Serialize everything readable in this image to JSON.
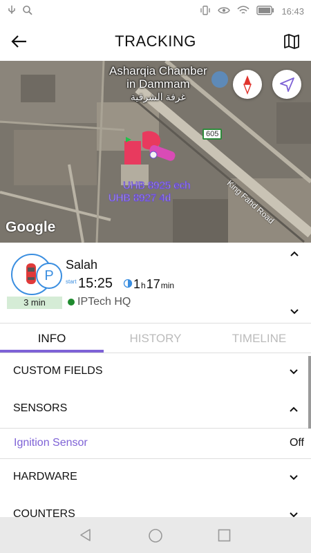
{
  "status_bar": {
    "time": "16:43",
    "icons_left": [
      "usb-icon",
      "search-icon"
    ],
    "icons_right": [
      "vibrate-icon",
      "eye-icon",
      "wifi-icon",
      "battery-icon"
    ]
  },
  "header": {
    "title": "TRACKING",
    "back_icon": "arrow-left-icon",
    "map_icon": "map-icon"
  },
  "map": {
    "poi_name_line1": "Asharqia Chamber",
    "poi_name_line2": "in Dammam",
    "poi_name_arabic": "غرفة الشرقية",
    "road_name": "King Fahd Road",
    "route_shield": "605",
    "vehicle_label_1": "UHB 8925 ech",
    "vehicle_label_2": "UHB 8927 4d",
    "attribution": "Google"
  },
  "driver_panel": {
    "name": "Salah",
    "start_label": "start",
    "start_time": "15:25",
    "duration_hours": "1",
    "duration_hours_unit": "h",
    "duration_minutes": "17",
    "duration_minutes_unit": "min",
    "location": "IPTech HQ",
    "trip_duration_badge": "3 min",
    "parked_badge": "P",
    "colors": {
      "accent_blue": "#3a8ee0",
      "location_dot": "#1e8a2e",
      "badge_bg": "#d5ecd6"
    }
  },
  "tabs": [
    {
      "label": "INFO",
      "active": true
    },
    {
      "label": "HISTORY",
      "active": false
    },
    {
      "label": "TIMELINE",
      "active": false
    }
  ],
  "sections": {
    "custom_fields": {
      "label": "CUSTOM FIELDS",
      "expanded": false
    },
    "sensors": {
      "label": "SENSORS",
      "expanded": true
    },
    "hardware": {
      "label": "HARDWARE",
      "expanded": false
    },
    "counters": {
      "label": "COUNTERS",
      "expanded": false
    }
  },
  "sensors_list": [
    {
      "name": "Ignition Sensor",
      "value": "Off"
    }
  ],
  "theme": {
    "tab_accent": "#7e62d6"
  }
}
